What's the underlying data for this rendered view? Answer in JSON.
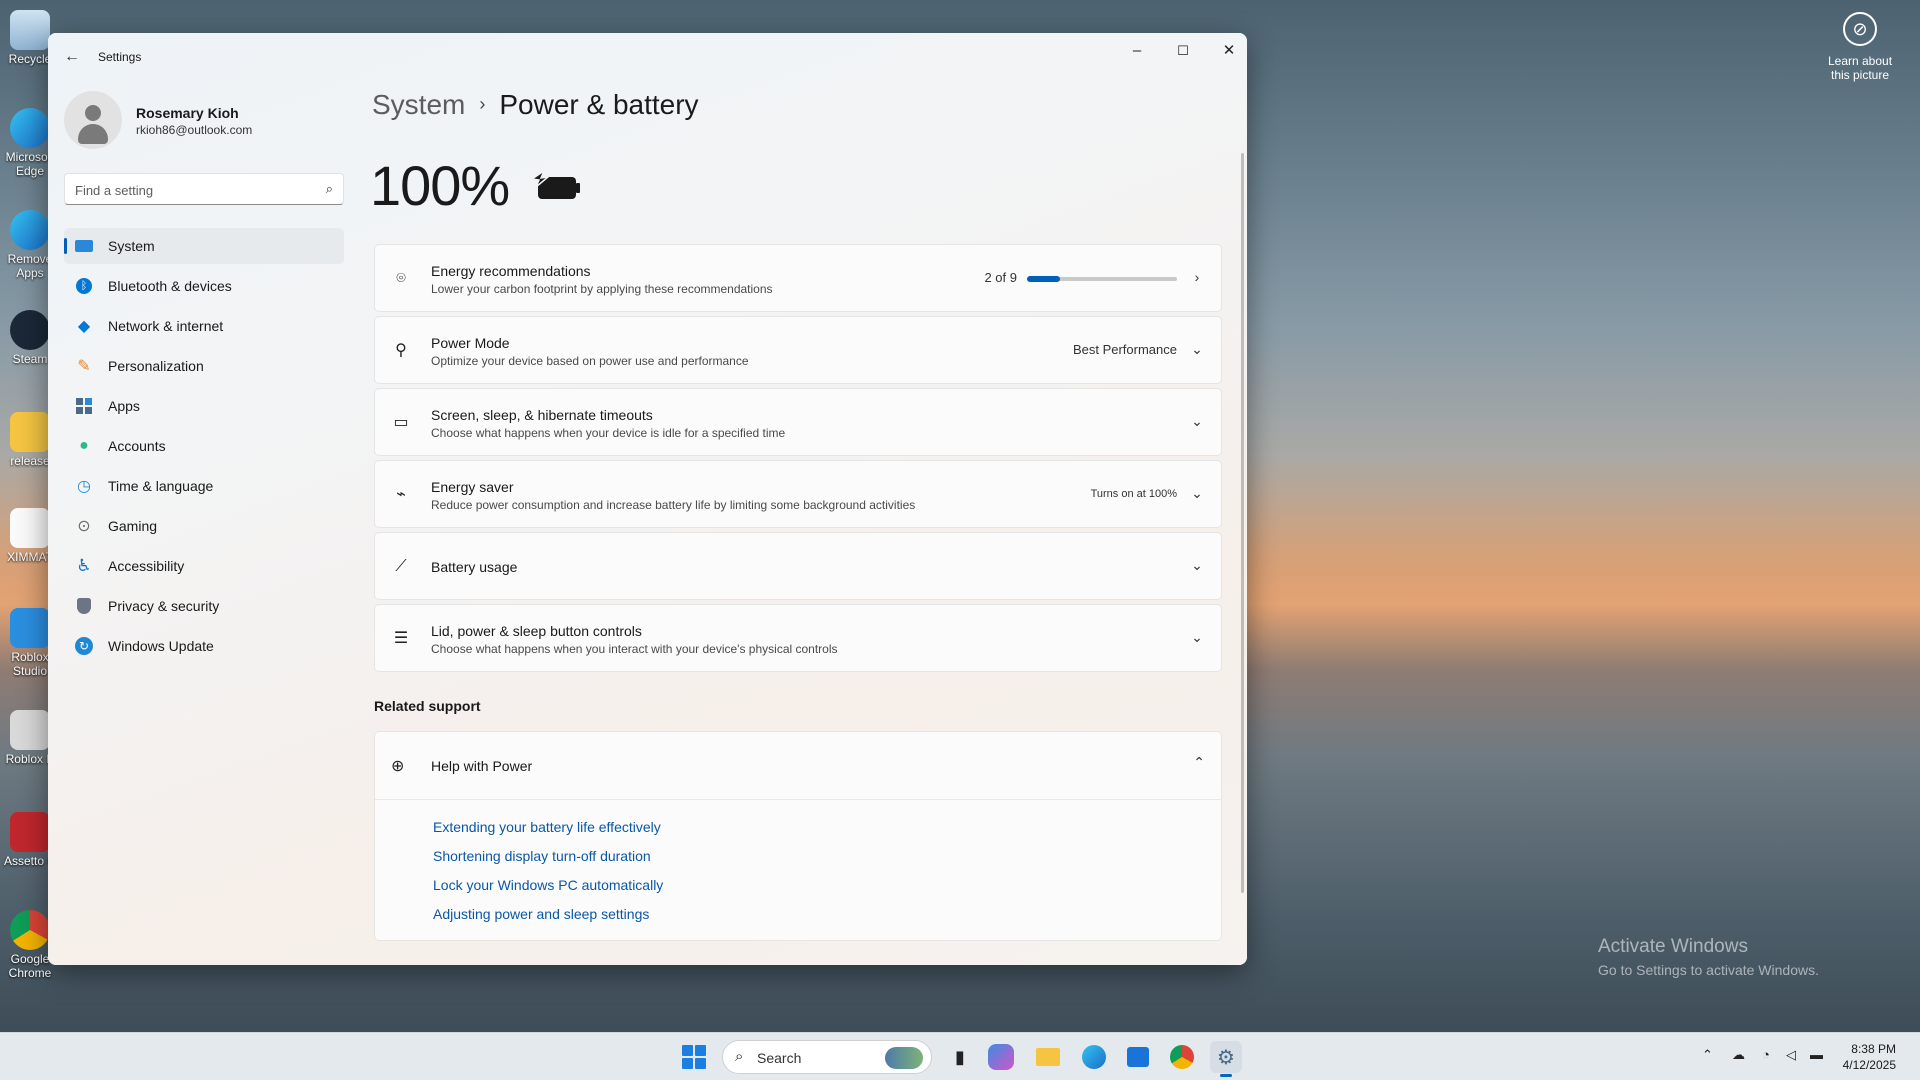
{
  "desktop": {
    "icons": [
      {
        "label": "Recycle",
        "icon": "recycle-bin-icon"
      },
      {
        "label": "Microsoft Edge",
        "icon": "edge-icon"
      },
      {
        "label": "Remove Apps",
        "icon": "edge-icon"
      },
      {
        "label": "Steam",
        "icon": "steam-icon"
      },
      {
        "label": "release",
        "icon": "folder-icon"
      },
      {
        "label": "XIMMAT",
        "icon": "file-icon"
      },
      {
        "label": "Roblox Studio",
        "icon": "roblox-studio-icon"
      },
      {
        "label": "Roblox P",
        "icon": "roblox-icon"
      },
      {
        "label": "Assetto C",
        "icon": "assetto-icon"
      },
      {
        "label": "Google Chrome",
        "icon": "chrome-icon"
      }
    ],
    "learn_label": "Learn about this picture",
    "activate_title": "Activate Windows",
    "activate_sub": "Go to Settings to activate Windows."
  },
  "window": {
    "title": "Settings",
    "back_icon": "back-arrow-icon",
    "minimize": "–",
    "maximize": "☐",
    "close": "✕"
  },
  "profile": {
    "name": "Rosemary Kioh",
    "email": "rkioh86@outlook.com"
  },
  "search": {
    "placeholder": "Find a setting"
  },
  "nav": {
    "items": [
      {
        "label": "System",
        "icon": "system-icon",
        "color": "#2b88d8",
        "active": true
      },
      {
        "label": "Bluetooth & devices",
        "icon": "bluetooth-icon",
        "color": "#0078d4"
      },
      {
        "label": "Network & internet",
        "icon": "wifi-icon",
        "color": "#0078d4"
      },
      {
        "label": "Personalization",
        "icon": "brush-icon",
        "color": "#e08a34"
      },
      {
        "label": "Apps",
        "icon": "apps-icon",
        "color": "#4a6a8a"
      },
      {
        "label": "Accounts",
        "icon": "accounts-icon",
        "color": "#2db88c"
      },
      {
        "label": "Time & language",
        "icon": "clock-globe-icon",
        "color": "#2b88d8"
      },
      {
        "label": "Gaming",
        "icon": "gamepad-icon",
        "color": "#6b6b6b"
      },
      {
        "label": "Accessibility",
        "icon": "accessibility-icon",
        "color": "#1673c4"
      },
      {
        "label": "Privacy & security",
        "icon": "shield-icon",
        "color": "#6b7585"
      },
      {
        "label": "Windows Update",
        "icon": "update-icon",
        "color": "#1e87d6"
      }
    ]
  },
  "main": {
    "breadcrumb_parent": "System",
    "breadcrumb_sep": "›",
    "page_title": "Power & battery",
    "battery_percent": "100%",
    "battery_icon": "battery-charging-icon",
    "cards": {
      "energy_rec": {
        "title": "Energy recommendations",
        "subtitle": "Lower your carbon footprint by applying these recommendations",
        "count": "2 of 9",
        "progress": 0.222,
        "icon": "leaf-icon"
      },
      "power_mode": {
        "title": "Power Mode",
        "subtitle": "Optimize your device based on power use and performance",
        "value": "Best Performance",
        "icon": "power-mode-icon"
      },
      "screen_sleep": {
        "title": "Screen, sleep, & hibernate timeouts",
        "subtitle": "Choose what happens when your device is idle for a specified time",
        "icon": "screen-sleep-icon"
      },
      "energy_saver": {
        "title": "Energy saver",
        "subtitle": "Reduce power consumption and increase battery life by limiting some background activities",
        "value": "Turns on at 100%",
        "icon": "energy-saver-icon"
      },
      "battery_usage": {
        "title": "Battery usage",
        "icon": "chart-line-icon"
      },
      "lid_power": {
        "title": "Lid, power & sleep button controls",
        "subtitle": "Choose what happens when you interact with your device's physical controls",
        "icon": "list-controls-icon"
      }
    },
    "related_heading": "Related support",
    "help": {
      "title": "Help with Power",
      "icon": "globe-icon",
      "links": [
        "Extending your battery life effectively",
        "Shortening display turn-off duration",
        "Lock your Windows PC automatically",
        "Adjusting power and sleep settings"
      ]
    }
  },
  "taskbar": {
    "search_label": "Search",
    "apps": [
      "file-explorer-dark-icon",
      "copilot-icon",
      "folder-icon",
      "edge-icon",
      "store-icon",
      "chrome-icon",
      "settings-icon"
    ],
    "time": "8:38 PM",
    "date": "4/12/2025"
  },
  "colors": {
    "accent": "#005fb8",
    "link": "#0a57a8"
  }
}
